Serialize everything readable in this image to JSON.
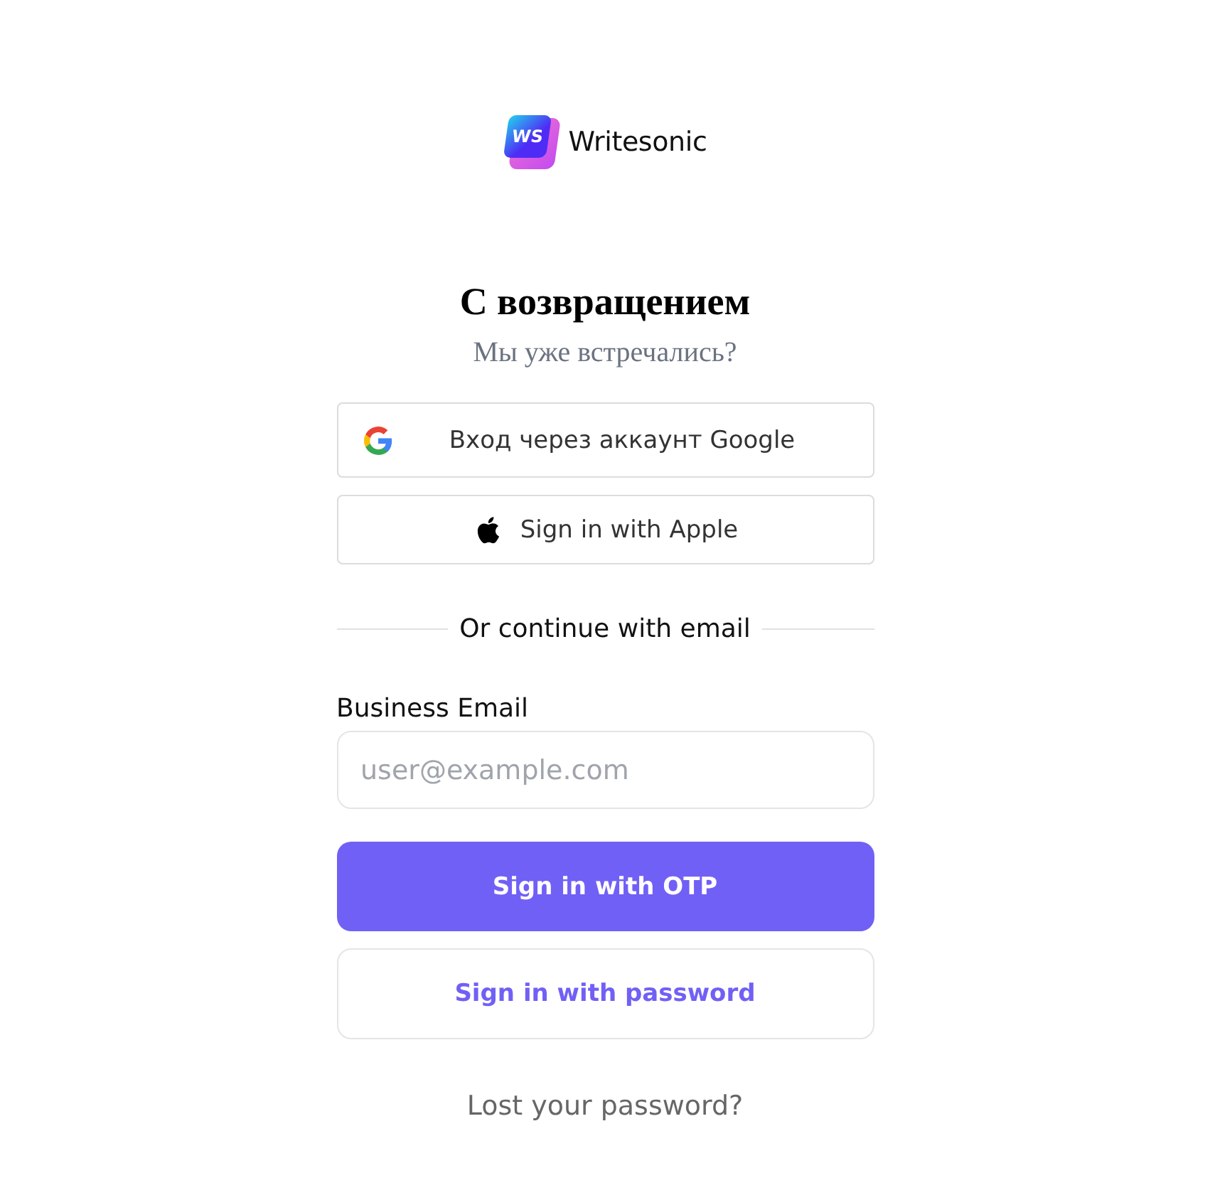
{
  "logo": {
    "badge": "WS",
    "name": "Writesonic"
  },
  "title": "С возвращением",
  "subtitle": "Мы уже встречались?",
  "social_buttons": [
    {
      "kind": "google",
      "label": "Вход через аккаунт Google"
    },
    {
      "kind": "apple",
      "label": "Sign in with Apple"
    }
  ],
  "divider": "Or continue with email",
  "email": {
    "label": "Business Email",
    "placeholder": "user@example.com"
  },
  "buttons": [
    {
      "kind": "primary",
      "label": "Sign in with OTP"
    },
    {
      "kind": "secondary",
      "label": "Sign in with password"
    }
  ],
  "lost_password_link": "Lost your password?"
}
